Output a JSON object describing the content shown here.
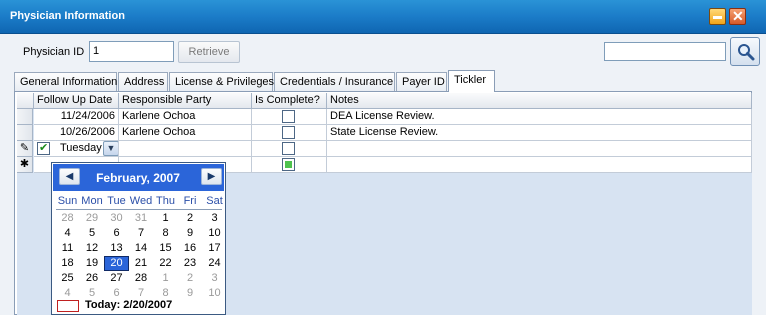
{
  "window": {
    "title": "Physician Information"
  },
  "form": {
    "physician_id_label": "Physician ID",
    "physician_id_value": "1",
    "retrieve_label": "Retrieve",
    "search_value": ""
  },
  "tabs": [
    {
      "label": "General Information"
    },
    {
      "label": "Address"
    },
    {
      "label": "License & Privileges"
    },
    {
      "label": "Credentials / Insurance"
    },
    {
      "label": "Payer ID"
    },
    {
      "label": "Tickler",
      "active": true
    }
  ],
  "grid": {
    "columns": [
      "Follow Up Date",
      "Responsible Party",
      "Is Complete?",
      "Notes"
    ],
    "rows": [
      {
        "date": "11/24/2006",
        "party": "Karlene Ochoa",
        "complete": false,
        "notes": "DEA License Review."
      },
      {
        "date": "10/26/2006",
        "party": "Karlene Ochoa",
        "complete": false,
        "notes": "State License Review."
      }
    ],
    "edit_row": {
      "indicator": "✎",
      "date_display": "Tuesday",
      "complete": false
    },
    "new_row": {
      "indicator": "✱",
      "complete": true
    }
  },
  "calendar": {
    "month_title": "February, 2007",
    "prev_icon": "◀",
    "next_icon": "▶",
    "weekdays": [
      "Sun",
      "Mon",
      "Tue",
      "Wed",
      "Thu",
      "Fri",
      "Sat"
    ],
    "weeks": [
      [
        "28",
        "29",
        "30",
        "31",
        "1",
        "2",
        "3"
      ],
      [
        "4",
        "5",
        "6",
        "7",
        "8",
        "9",
        "10"
      ],
      [
        "11",
        "12",
        "13",
        "14",
        "15",
        "16",
        "17"
      ],
      [
        "18",
        "19",
        "20",
        "21",
        "22",
        "23",
        "24"
      ],
      [
        "25",
        "26",
        "27",
        "28",
        "1",
        "2",
        "3"
      ],
      [
        "4",
        "5",
        "6",
        "7",
        "8",
        "9",
        "10"
      ]
    ],
    "selected_day": "20",
    "today_label": "Today: 2/20/2007"
  },
  "colors": {
    "titlebar": "#1b7cc8",
    "calendar_header": "#2b65d9",
    "grid_background": "#d7e3f2"
  }
}
